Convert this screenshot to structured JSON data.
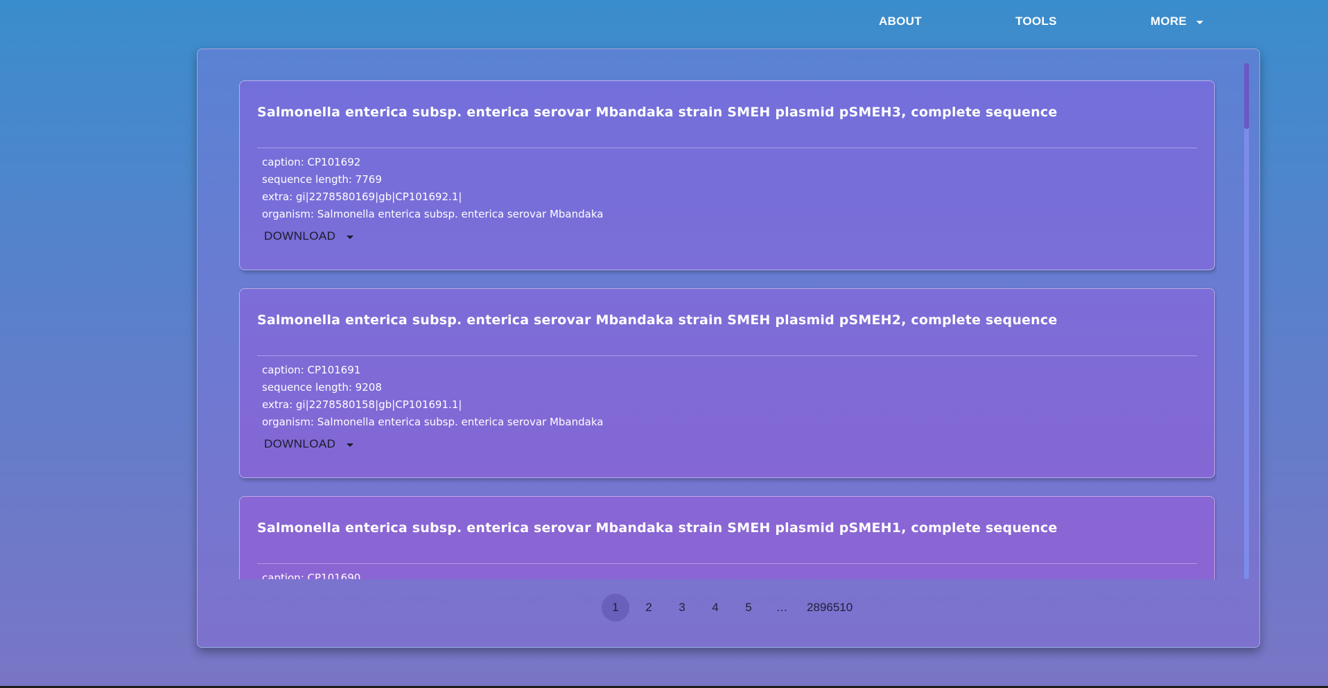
{
  "nav": {
    "about": "ABOUT",
    "tools": "TOOLS",
    "more": "MORE"
  },
  "cards": [
    {
      "title": "Salmonella enterica subsp. enterica serovar Mbandaka strain SMEH plasmid pSMEH3, complete sequence",
      "caption": "caption: CP101692",
      "sequence_length": "sequence length: 7769",
      "extra": "extra: gi|2278580169|gb|CP101692.1|",
      "organism": "organism: Salmonella enterica subsp. enterica serovar Mbandaka",
      "download_label": "DOWNLOAD"
    },
    {
      "title": "Salmonella enterica subsp. enterica serovar Mbandaka strain SMEH plasmid pSMEH2, complete sequence",
      "caption": "caption: CP101691",
      "sequence_length": "sequence length: 9208",
      "extra": "extra: gi|2278580158|gb|CP101691.1|",
      "organism": "organism: Salmonella enterica subsp. enterica serovar Mbandaka",
      "download_label": "DOWNLOAD"
    },
    {
      "title": "Salmonella enterica subsp. enterica serovar Mbandaka strain SMEH plasmid pSMEH1, complete sequence",
      "caption": "caption: CP101690"
    }
  ],
  "pagination": {
    "pages": [
      "1",
      "2",
      "3",
      "4",
      "5"
    ],
    "ellipsis": "…",
    "last": "2896510",
    "current": "1"
  },
  "colors": {
    "background_top": "#3a8dcc",
    "background_bottom": "#7a75c6",
    "card": "#7b6ed8",
    "text": "#ffffff"
  }
}
